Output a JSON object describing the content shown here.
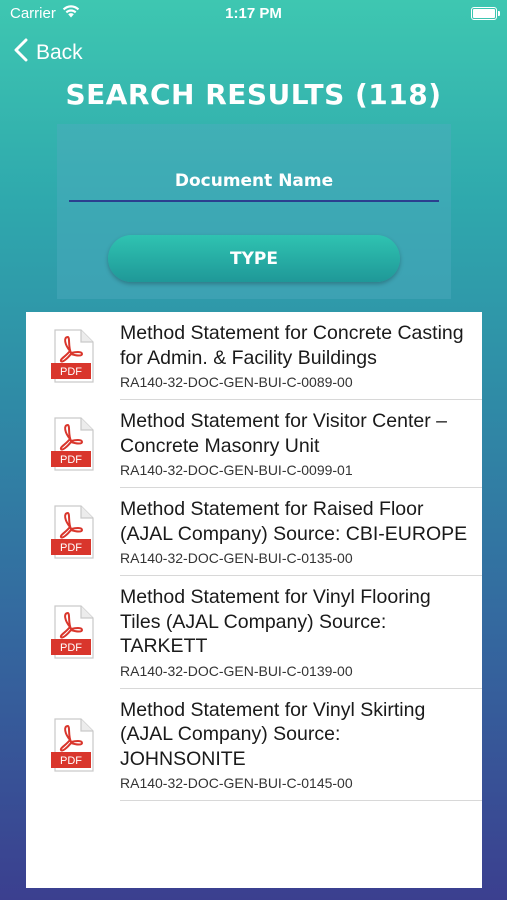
{
  "status_bar": {
    "carrier": "Carrier",
    "time": "1:17 PM",
    "wifi_icon": "wifi-icon",
    "battery_icon": "battery-icon"
  },
  "nav": {
    "back_label": "Back",
    "back_icon": "chevron-left-icon"
  },
  "page": {
    "title": "SEARCH RESULTS (118)"
  },
  "search": {
    "document_name_placeholder": "Document Name",
    "document_name_value": "",
    "type_button_label": "TYPE"
  },
  "results": [
    {
      "title": "Method Statement for Concrete Casting for Admin. & Facility Buildings",
      "code": "RA140-32-DOC-GEN-BUI-C-0089-00",
      "icon": "pdf-icon"
    },
    {
      "title": "Method Statement for Visitor Center – Concrete Masonry Unit",
      "code": "RA140-32-DOC-GEN-BUI-C-0099-01",
      "icon": "pdf-icon"
    },
    {
      "title": "Method Statement for Raised Floor (AJAL Company) Source: CBI-EUROPE",
      "code": "RA140-32-DOC-GEN-BUI-C-0135-00",
      "icon": "pdf-icon"
    },
    {
      "title": "Method Statement for Vinyl Flooring Tiles (AJAL Company) Source: TARKETT",
      "code": "RA140-32-DOC-GEN-BUI-C-0139-00",
      "icon": "pdf-icon"
    },
    {
      "title": "Method Statement for Vinyl Skirting (AJAL Company) Source: JOHNSONITE",
      "code": "RA140-32-DOC-GEN-BUI-C-0145-00",
      "icon": "pdf-icon"
    }
  ],
  "pdf_badge_text": "PDF",
  "colors": {
    "background_top": "#3ec7b1",
    "background_bottom": "#3b3f8f",
    "input_underline": "#2b3f8f",
    "pdf_red": "#d9362c"
  }
}
